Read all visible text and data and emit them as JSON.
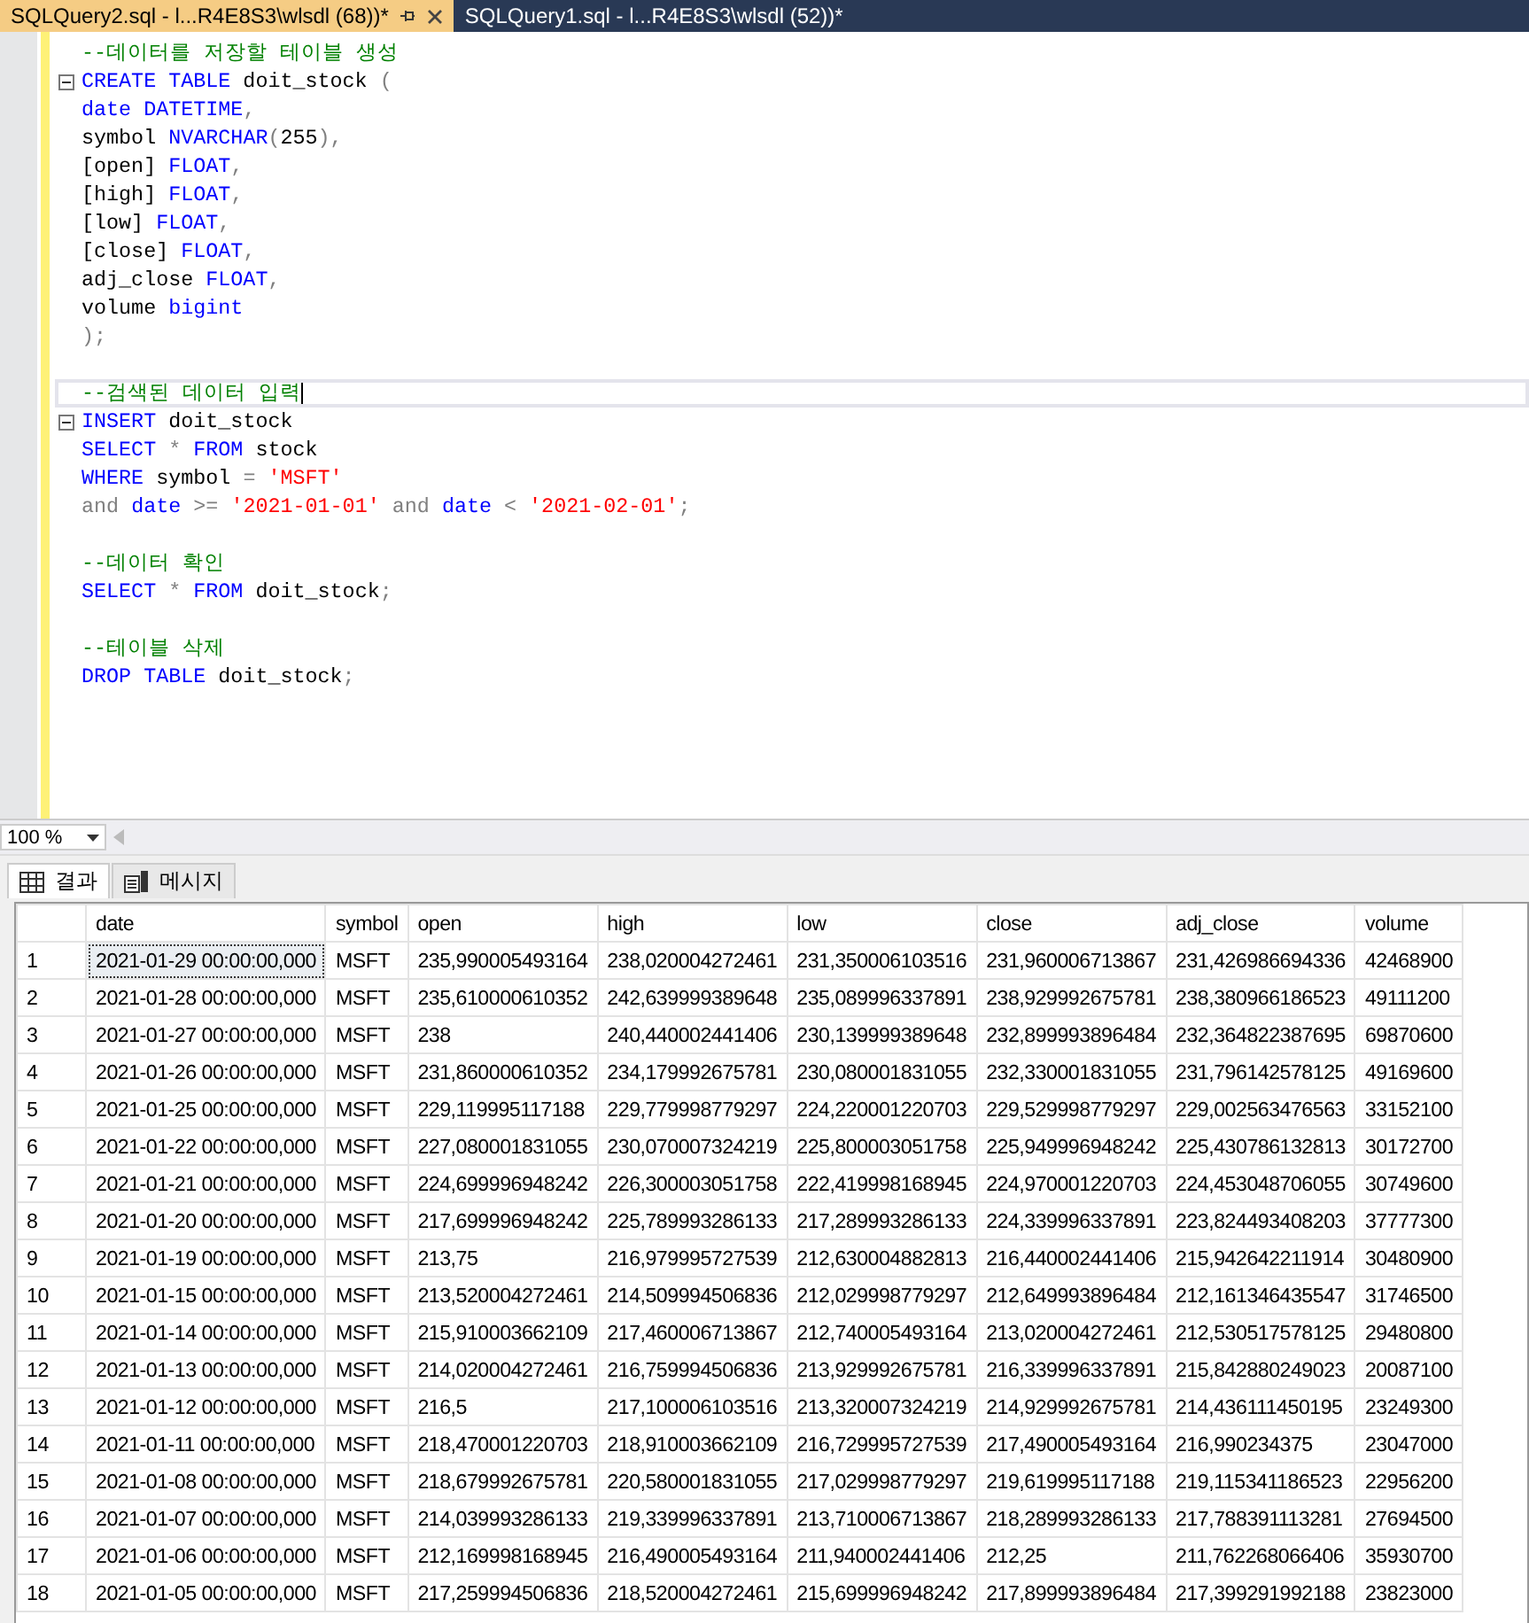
{
  "tabs": [
    {
      "label": "SQLQuery2.sql - l...R4E8S3\\wlsdl (68))*",
      "selected": true
    },
    {
      "label": "SQLQuery1.sql - l...R4E8S3\\wlsdl (52))*",
      "selected": false
    }
  ],
  "editor": {
    "lines": [
      {
        "fold": false,
        "current": false,
        "tokens": [
          {
            "t": "--데이터를 저장할 테이블 생성",
            "kind": "comment"
          }
        ]
      },
      {
        "fold": true,
        "current": false,
        "tokens": [
          {
            "t": "CREATE TABLE",
            "kind": "keyword"
          },
          {
            "t": " doit_stock ",
            "kind": "text"
          },
          {
            "t": "(",
            "kind": "operator"
          }
        ]
      },
      {
        "fold": false,
        "current": false,
        "tokens": [
          {
            "t": "date DATETIME",
            "kind": "keyword"
          },
          {
            "t": ",",
            "kind": "operator"
          }
        ]
      },
      {
        "fold": false,
        "current": false,
        "tokens": [
          {
            "t": "symbol ",
            "kind": "text"
          },
          {
            "t": "NVARCHAR",
            "kind": "keyword"
          },
          {
            "t": "(",
            "kind": "operator"
          },
          {
            "t": "255",
            "kind": "text"
          },
          {
            "t": "),",
            "kind": "operator"
          }
        ]
      },
      {
        "fold": false,
        "current": false,
        "tokens": [
          {
            "t": "[open] ",
            "kind": "text"
          },
          {
            "t": "FLOAT",
            "kind": "keyword"
          },
          {
            "t": ",",
            "kind": "operator"
          }
        ]
      },
      {
        "fold": false,
        "current": false,
        "tokens": [
          {
            "t": "[high] ",
            "kind": "text"
          },
          {
            "t": "FLOAT",
            "kind": "keyword"
          },
          {
            "t": ",",
            "kind": "operator"
          }
        ]
      },
      {
        "fold": false,
        "current": false,
        "tokens": [
          {
            "t": "[low] ",
            "kind": "text"
          },
          {
            "t": "FLOAT",
            "kind": "keyword"
          },
          {
            "t": ",",
            "kind": "operator"
          }
        ]
      },
      {
        "fold": false,
        "current": false,
        "tokens": [
          {
            "t": "[close] ",
            "kind": "text"
          },
          {
            "t": "FLOAT",
            "kind": "keyword"
          },
          {
            "t": ",",
            "kind": "operator"
          }
        ]
      },
      {
        "fold": false,
        "current": false,
        "tokens": [
          {
            "t": "adj_close ",
            "kind": "text"
          },
          {
            "t": "FLOAT",
            "kind": "keyword"
          },
          {
            "t": ",",
            "kind": "operator"
          }
        ]
      },
      {
        "fold": false,
        "current": false,
        "tokens": [
          {
            "t": "volume ",
            "kind": "text"
          },
          {
            "t": "bigint",
            "kind": "keyword"
          }
        ]
      },
      {
        "fold": false,
        "current": false,
        "tokens": [
          {
            "t": ");",
            "kind": "operator"
          }
        ]
      },
      {
        "fold": false,
        "current": false
      },
      {
        "fold": false,
        "current": true,
        "tokens": [
          {
            "t": "--검색된 데이터 입력",
            "kind": "comment"
          }
        ]
      },
      {
        "fold": true,
        "current": false,
        "tokens": [
          {
            "t": "INSERT",
            "kind": "keyword"
          },
          {
            "t": " doit_stock",
            "kind": "text"
          }
        ]
      },
      {
        "fold": false,
        "current": false,
        "tokens": [
          {
            "t": "SELECT ",
            "kind": "keyword"
          },
          {
            "t": "* ",
            "kind": "operator"
          },
          {
            "t": "FROM",
            "kind": "keyword"
          },
          {
            "t": " stock",
            "kind": "text"
          }
        ]
      },
      {
        "fold": false,
        "current": false,
        "tokens": [
          {
            "t": "WHERE",
            "kind": "keyword"
          },
          {
            "t": " symbol ",
            "kind": "text"
          },
          {
            "t": "= ",
            "kind": "operator"
          },
          {
            "t": "'MSFT'",
            "kind": "string"
          }
        ]
      },
      {
        "fold": false,
        "current": false,
        "tokens": [
          {
            "t": "and ",
            "kind": "operator"
          },
          {
            "t": "date ",
            "kind": "keyword"
          },
          {
            "t": ">= ",
            "kind": "operator"
          },
          {
            "t": "'2021-01-01'",
            "kind": "string"
          },
          {
            "t": " and ",
            "kind": "operator"
          },
          {
            "t": "date ",
            "kind": "keyword"
          },
          {
            "t": "< ",
            "kind": "operator"
          },
          {
            "t": "'2021-02-01'",
            "kind": "string"
          },
          {
            "t": ";",
            "kind": "operator"
          }
        ]
      },
      {
        "fold": false,
        "current": false
      },
      {
        "fold": false,
        "current": false,
        "tokens": [
          {
            "t": "--데이터 확인",
            "kind": "comment"
          }
        ]
      },
      {
        "fold": false,
        "current": false,
        "tokens": [
          {
            "t": "SELECT ",
            "kind": "keyword"
          },
          {
            "t": "* ",
            "kind": "operator"
          },
          {
            "t": "FROM",
            "kind": "keyword"
          },
          {
            "t": " doit_stock",
            "kind": "text"
          },
          {
            "t": ";",
            "kind": "operator"
          }
        ]
      },
      {
        "fold": false,
        "current": false
      },
      {
        "fold": false,
        "current": false,
        "tokens": [
          {
            "t": "--테이블 삭제",
            "kind": "comment"
          }
        ]
      },
      {
        "fold": false,
        "current": false,
        "tokens": [
          {
            "t": "DROP TABLE",
            "kind": "keyword"
          },
          {
            "t": " doit_stock",
            "kind": "text"
          },
          {
            "t": ";",
            "kind": "operator"
          }
        ]
      }
    ]
  },
  "zoom": "100 %",
  "result_tabs": [
    {
      "label": "결과",
      "kind": "grid",
      "selected": true
    },
    {
      "label": "메시지",
      "kind": "messages",
      "selected": false
    }
  ],
  "grid": {
    "columns": [
      "date",
      "symbol",
      "open",
      "high",
      "low",
      "close",
      "adj_close",
      "volume"
    ],
    "rows": [
      {
        "number": "1",
        "selected": true,
        "cells": [
          "2021-01-29 00:00:00,000",
          "MSFT",
          "235,990005493164",
          "238,020004272461",
          "231,350006103516",
          "231,960006713867",
          "231,426986694336",
          "42468900"
        ]
      },
      {
        "number": "2",
        "selected": false,
        "cells": [
          "2021-01-28 00:00:00,000",
          "MSFT",
          "235,610000610352",
          "242,639999389648",
          "235,089996337891",
          "238,929992675781",
          "238,380966186523",
          "49111200"
        ]
      },
      {
        "number": "3",
        "selected": false,
        "cells": [
          "2021-01-27 00:00:00,000",
          "MSFT",
          "238",
          "240,440002441406",
          "230,139999389648",
          "232,899993896484",
          "232,364822387695",
          "69870600"
        ]
      },
      {
        "number": "4",
        "selected": false,
        "cells": [
          "2021-01-26 00:00:00,000",
          "MSFT",
          "231,860000610352",
          "234,179992675781",
          "230,080001831055",
          "232,330001831055",
          "231,796142578125",
          "49169600"
        ]
      },
      {
        "number": "5",
        "selected": false,
        "cells": [
          "2021-01-25 00:00:00,000",
          "MSFT",
          "229,119995117188",
          "229,779998779297",
          "224,220001220703",
          "229,529998779297",
          "229,002563476563",
          "33152100"
        ]
      },
      {
        "number": "6",
        "selected": false,
        "cells": [
          "2021-01-22 00:00:00,000",
          "MSFT",
          "227,080001831055",
          "230,070007324219",
          "225,800003051758",
          "225,949996948242",
          "225,430786132813",
          "30172700"
        ]
      },
      {
        "number": "7",
        "selected": false,
        "cells": [
          "2021-01-21 00:00:00,000",
          "MSFT",
          "224,699996948242",
          "226,300003051758",
          "222,419998168945",
          "224,970001220703",
          "224,453048706055",
          "30749600"
        ]
      },
      {
        "number": "8",
        "selected": false,
        "cells": [
          "2021-01-20 00:00:00,000",
          "MSFT",
          "217,699996948242",
          "225,789993286133",
          "217,289993286133",
          "224,339996337891",
          "223,824493408203",
          "37777300"
        ]
      },
      {
        "number": "9",
        "selected": false,
        "cells": [
          "2021-01-19 00:00:00,000",
          "MSFT",
          "213,75",
          "216,979995727539",
          "212,630004882813",
          "216,440002441406",
          "215,942642211914",
          "30480900"
        ]
      },
      {
        "number": "10",
        "selected": false,
        "cells": [
          "2021-01-15 00:00:00,000",
          "MSFT",
          "213,520004272461",
          "214,509994506836",
          "212,029998779297",
          "212,649993896484",
          "212,161346435547",
          "31746500"
        ]
      },
      {
        "number": "11",
        "selected": false,
        "cells": [
          "2021-01-14 00:00:00,000",
          "MSFT",
          "215,910003662109",
          "217,460006713867",
          "212,740005493164",
          "213,020004272461",
          "212,530517578125",
          "29480800"
        ]
      },
      {
        "number": "12",
        "selected": false,
        "cells": [
          "2021-01-13 00:00:00,000",
          "MSFT",
          "214,020004272461",
          "216,759994506836",
          "213,929992675781",
          "216,339996337891",
          "215,842880249023",
          "20087100"
        ]
      },
      {
        "number": "13",
        "selected": false,
        "cells": [
          "2021-01-12 00:00:00,000",
          "MSFT",
          "216,5",
          "217,100006103516",
          "213,320007324219",
          "214,929992675781",
          "214,436111450195",
          "23249300"
        ]
      },
      {
        "number": "14",
        "selected": false,
        "cells": [
          "2021-01-11 00:00:00,000",
          "MSFT",
          "218,470001220703",
          "218,910003662109",
          "216,729995727539",
          "217,490005493164",
          "216,990234375",
          "23047000"
        ]
      },
      {
        "number": "15",
        "selected": false,
        "cells": [
          "2021-01-08 00:00:00,000",
          "MSFT",
          "218,679992675781",
          "220,580001831055",
          "217,029998779297",
          "219,619995117188",
          "219,115341186523",
          "22956200"
        ]
      },
      {
        "number": "16",
        "selected": false,
        "cells": [
          "2021-01-07 00:00:00,000",
          "MSFT",
          "214,039993286133",
          "219,339996337891",
          "213,710006713867",
          "218,289993286133",
          "217,788391113281",
          "27694500"
        ]
      },
      {
        "number": "17",
        "selected": false,
        "cells": [
          "2021-01-06 00:00:00,000",
          "MSFT",
          "212,169998168945",
          "216,490005493164",
          "211,940002441406",
          "212,25",
          "211,762268066406",
          "35930700"
        ]
      },
      {
        "number": "18",
        "selected": false,
        "cells": [
          "2021-01-05 00:00:00,000",
          "MSFT",
          "217,259994506836",
          "218,520004272461",
          "215,699996948242",
          "217,899993896484",
          "217,399291992188",
          "23823000"
        ]
      }
    ]
  }
}
